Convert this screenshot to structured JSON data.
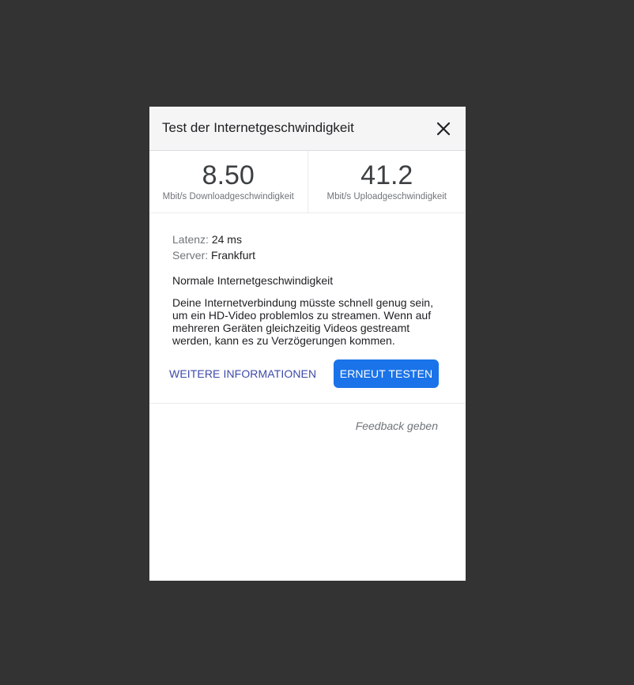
{
  "dialog": {
    "title": "Test der Internetgeschwindigkeit",
    "close_icon": "close-icon"
  },
  "stats": {
    "download": {
      "value": "8.50",
      "label": "Mbit/s Downloadgeschwindigkeit"
    },
    "upload": {
      "value": "41.2",
      "label": "Mbit/s Uploadgeschwindigkeit"
    }
  },
  "details": {
    "latency_label": "Latenz:",
    "latency_value": "24 ms",
    "server_label": "Server:",
    "server_value": "Frankfurt",
    "status": "Normale Internetgeschwindigkeit",
    "description": "Deine Internetverbindung müsste schnell genug sein, um ein HD-Video problemlos zu streamen. Wenn auf mehreren Geräten gleichzeitig Videos gestreamt werden, kann es zu Verzögerungen kommen."
  },
  "actions": {
    "more_info": "WEITERE INFORMATIONEN",
    "retest": "ERNEUT TESTEN"
  },
  "footer": {
    "feedback": "Feedback geben"
  },
  "colors": {
    "backdrop": "#333333",
    "accent": "#1a73e8",
    "link": "#3c4aa8"
  }
}
